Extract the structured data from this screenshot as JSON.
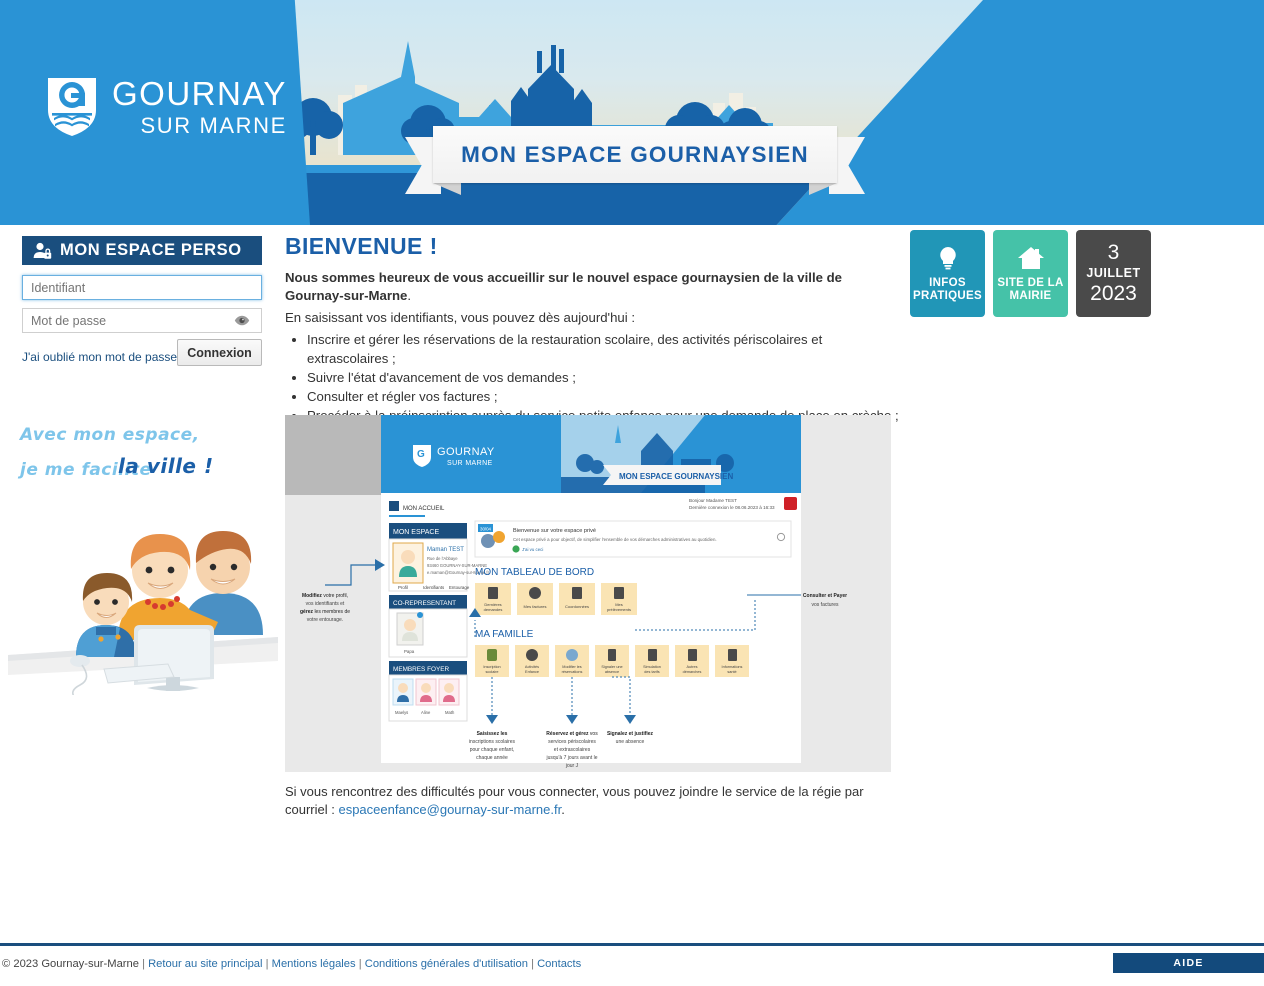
{
  "header": {
    "logo": {
      "line1": "GOURNAY",
      "line2": "SUR MARNE",
      "crest_icon": "gournay-crest-icon"
    },
    "banner_title": "MON ESPACE GOURNAYSIEN"
  },
  "login": {
    "panel_title": "MON ESPACE PERSO",
    "panel_icon": "user-lock-icon",
    "identifier_placeholder": "Identifiant",
    "identifier_value": "",
    "password_placeholder": "Mot de passe",
    "password_value": "",
    "toggle_password_icon": "eye-icon",
    "forgot_label": "J'ai oublié mon mot de passe.",
    "submit_label": "Connexion"
  },
  "promo": {
    "line1": "Avec mon espace,",
    "line2": "je me facilite",
    "line3": "la ville !",
    "illustration": "family-at-computer-illustration"
  },
  "main": {
    "heading": "BIENVENUE !",
    "lead_bold": "Nous sommes heureux de vous accueillir sur le nouvel espace gournaysien de la ville de Gournay-sur-Marne",
    "lead_tail": ".",
    "subheading": "En saisissant vos identifiants, vous pouvez dès aujourd'hui :",
    "benefits": [
      "Inscrire et gérer les réservations de la restauration scolaire, des activités périscolaires et extrascolaires ;",
      "Suivre l'état d'avancement de vos demandes ;",
      "Consulter et régler vos factures ;",
      "Procéder à la préinscription auprès du service petite enfance pour une demande de place en crèche ;"
    ],
    "outro_text": "Si vous rencontrez des difficultés pour vous connecter, vous pouvez joindre le service de la régie par courriel : ",
    "outro_email": "espaceenfance@gournay-sur-marne.fr",
    "outro_end": "."
  },
  "screenshot": {
    "alt": "capture-ecran-tutoriel-espace-gournaysien",
    "inner_logo_line1": "GOURNAY",
    "inner_logo_line2": "SUR MARNE",
    "inner_banner": "MON ESPACE GOURNAYSIEN",
    "breadcrumb": "MON ACCUEIL",
    "greeting": "Bonjour Madame TEST",
    "last_connection": "Dernière connexion le 08.06.2023 à 16:33",
    "notice_title": "Bienvenue sur votre espace privé",
    "notice_text": "Cet espace privé a pour objectif, de simplifier l'ensemble de vos démarches administratives au quotidien.",
    "notice_link": "J'ai vu ceci",
    "notice_badge": "30/04",
    "panel_mon_espace": "MON ESPACE",
    "user_name": "Maman TEST",
    "user_addr1": "Rue de l'Abbaye",
    "user_addr2": "93460 GOURNAY-SUR-MARNE",
    "user_addr3": "e.maman@Gournay-sur-Marne.fr",
    "tabs": [
      "Profil",
      "Identifiants",
      "Entourage"
    ],
    "panel_corep": "CO-REPRESENTANT",
    "corep_name": "Papa",
    "panel_foyer": "MEMBRES FOYER",
    "foyer_members": [
      "Maelys",
      "Aline",
      "Math"
    ],
    "dashboard_title": "MON TABLEAU DE BORD",
    "dashboard_tiles": [
      "Dernières demandes",
      "Mes factures",
      "Coordonnées",
      "Mes prélèvements"
    ],
    "family_title": "MA FAMILLE",
    "family_tiles": [
      "Inscription scolaire",
      "Activités Enfance",
      "Modifier les réservations",
      "Signaler une absence",
      "Simulation des tarifs",
      "Autres démarches",
      "Informations santé"
    ],
    "callouts": [
      "Modifiez votre profil, vos identifiants et gérez les membres de votre entourage.",
      "Saisissez les inscriptions scolaires pour chaque enfant, chaque année",
      "Réservez et gérez vos services périscolaires et extrascolaires jusqu'à 7 jours avant le jour J",
      "Signalez et justifiez une absence",
      "Consulter et Payer vos factures"
    ]
  },
  "tiles": [
    {
      "id": "infos",
      "icon": "lightbulb-icon",
      "line1": "INFOS",
      "line2": "PRATIQUES",
      "color": "#2196b7"
    },
    {
      "id": "mairie",
      "icon": "home-icon",
      "line1": "SITE DE LA",
      "line2": "MAIRIE",
      "color": "#45c2a8"
    }
  ],
  "date_tile": {
    "day": "3",
    "month": "JUILLET",
    "year": "2023",
    "color": "#4a4a4a"
  },
  "footer": {
    "copyright": "© 2023 Gournay-sur-Marne",
    "links": [
      "Retour au site principal",
      "Mentions légales",
      "Conditions générales d'utilisation",
      "Contacts"
    ],
    "separator": "|",
    "help_label": "AIDE"
  },
  "colors": {
    "header_blue": "#2a93d5",
    "deep_blue": "#1763a8",
    "navy": "#1a4e7e",
    "accent_link": "#2a77b5"
  }
}
